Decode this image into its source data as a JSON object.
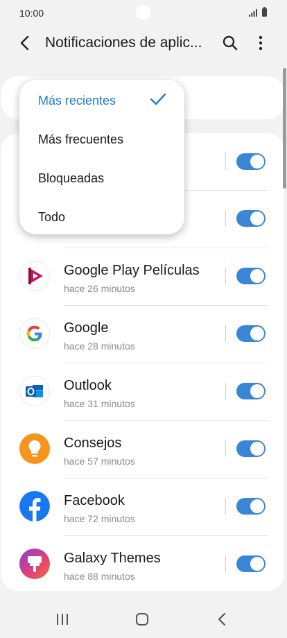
{
  "status_bar": {
    "time": "10:00"
  },
  "header": {
    "title": "Notificaciones de aplic..."
  },
  "dropdown": {
    "items": [
      {
        "label": "Más recientes",
        "selected": true
      },
      {
        "label": "Más frecuentes",
        "selected": false
      },
      {
        "label": "Bloqueadas",
        "selected": false
      },
      {
        "label": "Todo",
        "selected": false
      }
    ]
  },
  "apps": [
    {
      "name": "",
      "time": "",
      "enabled": true,
      "icon": "hidden-app-icon"
    },
    {
      "name": "",
      "time": "",
      "enabled": true,
      "icon": "hidden-app-icon"
    },
    {
      "name": "Google Play Películas",
      "time": "hace 26 minutos",
      "enabled": true,
      "icon": "google-play-movies-icon"
    },
    {
      "name": "Google",
      "time": "hace 28 minutos",
      "enabled": true,
      "icon": "google-icon"
    },
    {
      "name": "Outlook",
      "time": "hace 31 minutos",
      "enabled": true,
      "icon": "outlook-icon"
    },
    {
      "name": "Consejos",
      "time": "hace 57 minutos",
      "enabled": true,
      "icon": "tips-lightbulb-icon"
    },
    {
      "name": "Facebook",
      "time": "hace 72 minutos",
      "enabled": true,
      "icon": "facebook-icon"
    },
    {
      "name": "Galaxy Themes",
      "time": "hace 88 minutos",
      "enabled": true,
      "icon": "galaxy-themes-icon"
    }
  ],
  "colors": {
    "accent": "#1d7bc9",
    "toggle_on": "#3a86d6",
    "background": "#f2f2f2"
  }
}
